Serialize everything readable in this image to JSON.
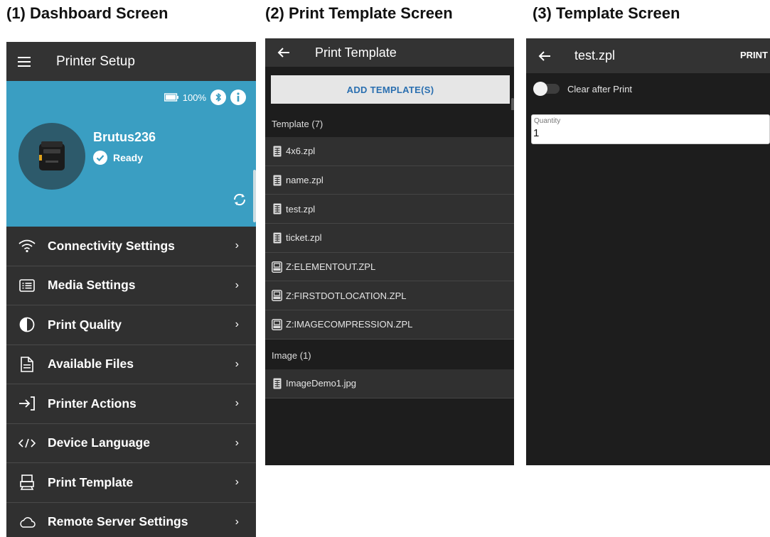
{
  "headings": {
    "dashboard": "(1) Dashboard Screen",
    "print_template": "(2) Print Template Screen",
    "template": "(3) Template Screen"
  },
  "dashboard": {
    "title": "Printer Setup",
    "battery_percent": "100%",
    "printer_name": "Brutus236",
    "printer_status": "Ready",
    "accent_color": "#3a9ec2",
    "menu_items": [
      {
        "label": "Connectivity Settings",
        "icon": "wifi-icon"
      },
      {
        "label": "Media Settings",
        "icon": "list-icon"
      },
      {
        "label": "Print Quality",
        "icon": "contrast-icon"
      },
      {
        "label": "Available Files",
        "icon": "file-icon"
      },
      {
        "label": "Printer Actions",
        "icon": "enter-icon"
      },
      {
        "label": "Device Language",
        "icon": "code-icon"
      },
      {
        "label": "Print Template",
        "icon": "template-icon"
      },
      {
        "label": "Remote Server Settings",
        "icon": "cloud-icon"
      }
    ]
  },
  "print_template_screen": {
    "title": "Print Template",
    "add_button": "ADD TEMPLATE(S)",
    "template_section": "Template  (7)",
    "templates": [
      {
        "name": "4x6.zpl",
        "icon": "grid-file-icon"
      },
      {
        "name": "name.zpl",
        "icon": "grid-file-icon"
      },
      {
        "name": "test.zpl",
        "icon": "grid-file-icon"
      },
      {
        "name": "ticket.zpl",
        "icon": "grid-file-icon"
      },
      {
        "name": "Z:ELEMENTOUT.ZPL",
        "icon": "printer-file-icon"
      },
      {
        "name": "Z:FIRSTDOTLOCATION.ZPL",
        "icon": "printer-file-icon"
      },
      {
        "name": "Z:IMAGECOMPRESSION.ZPL",
        "icon": "printer-file-icon"
      }
    ],
    "image_section": "Image  (1)",
    "images": [
      {
        "name": "ImageDemo1.jpg",
        "icon": "grid-file-icon"
      }
    ]
  },
  "template_screen": {
    "title": "test.zpl",
    "print_button": "PRINT",
    "toggle_label": "Clear after Print",
    "toggle_on": false,
    "quantity_label": "Quantity",
    "quantity_value": "1"
  }
}
